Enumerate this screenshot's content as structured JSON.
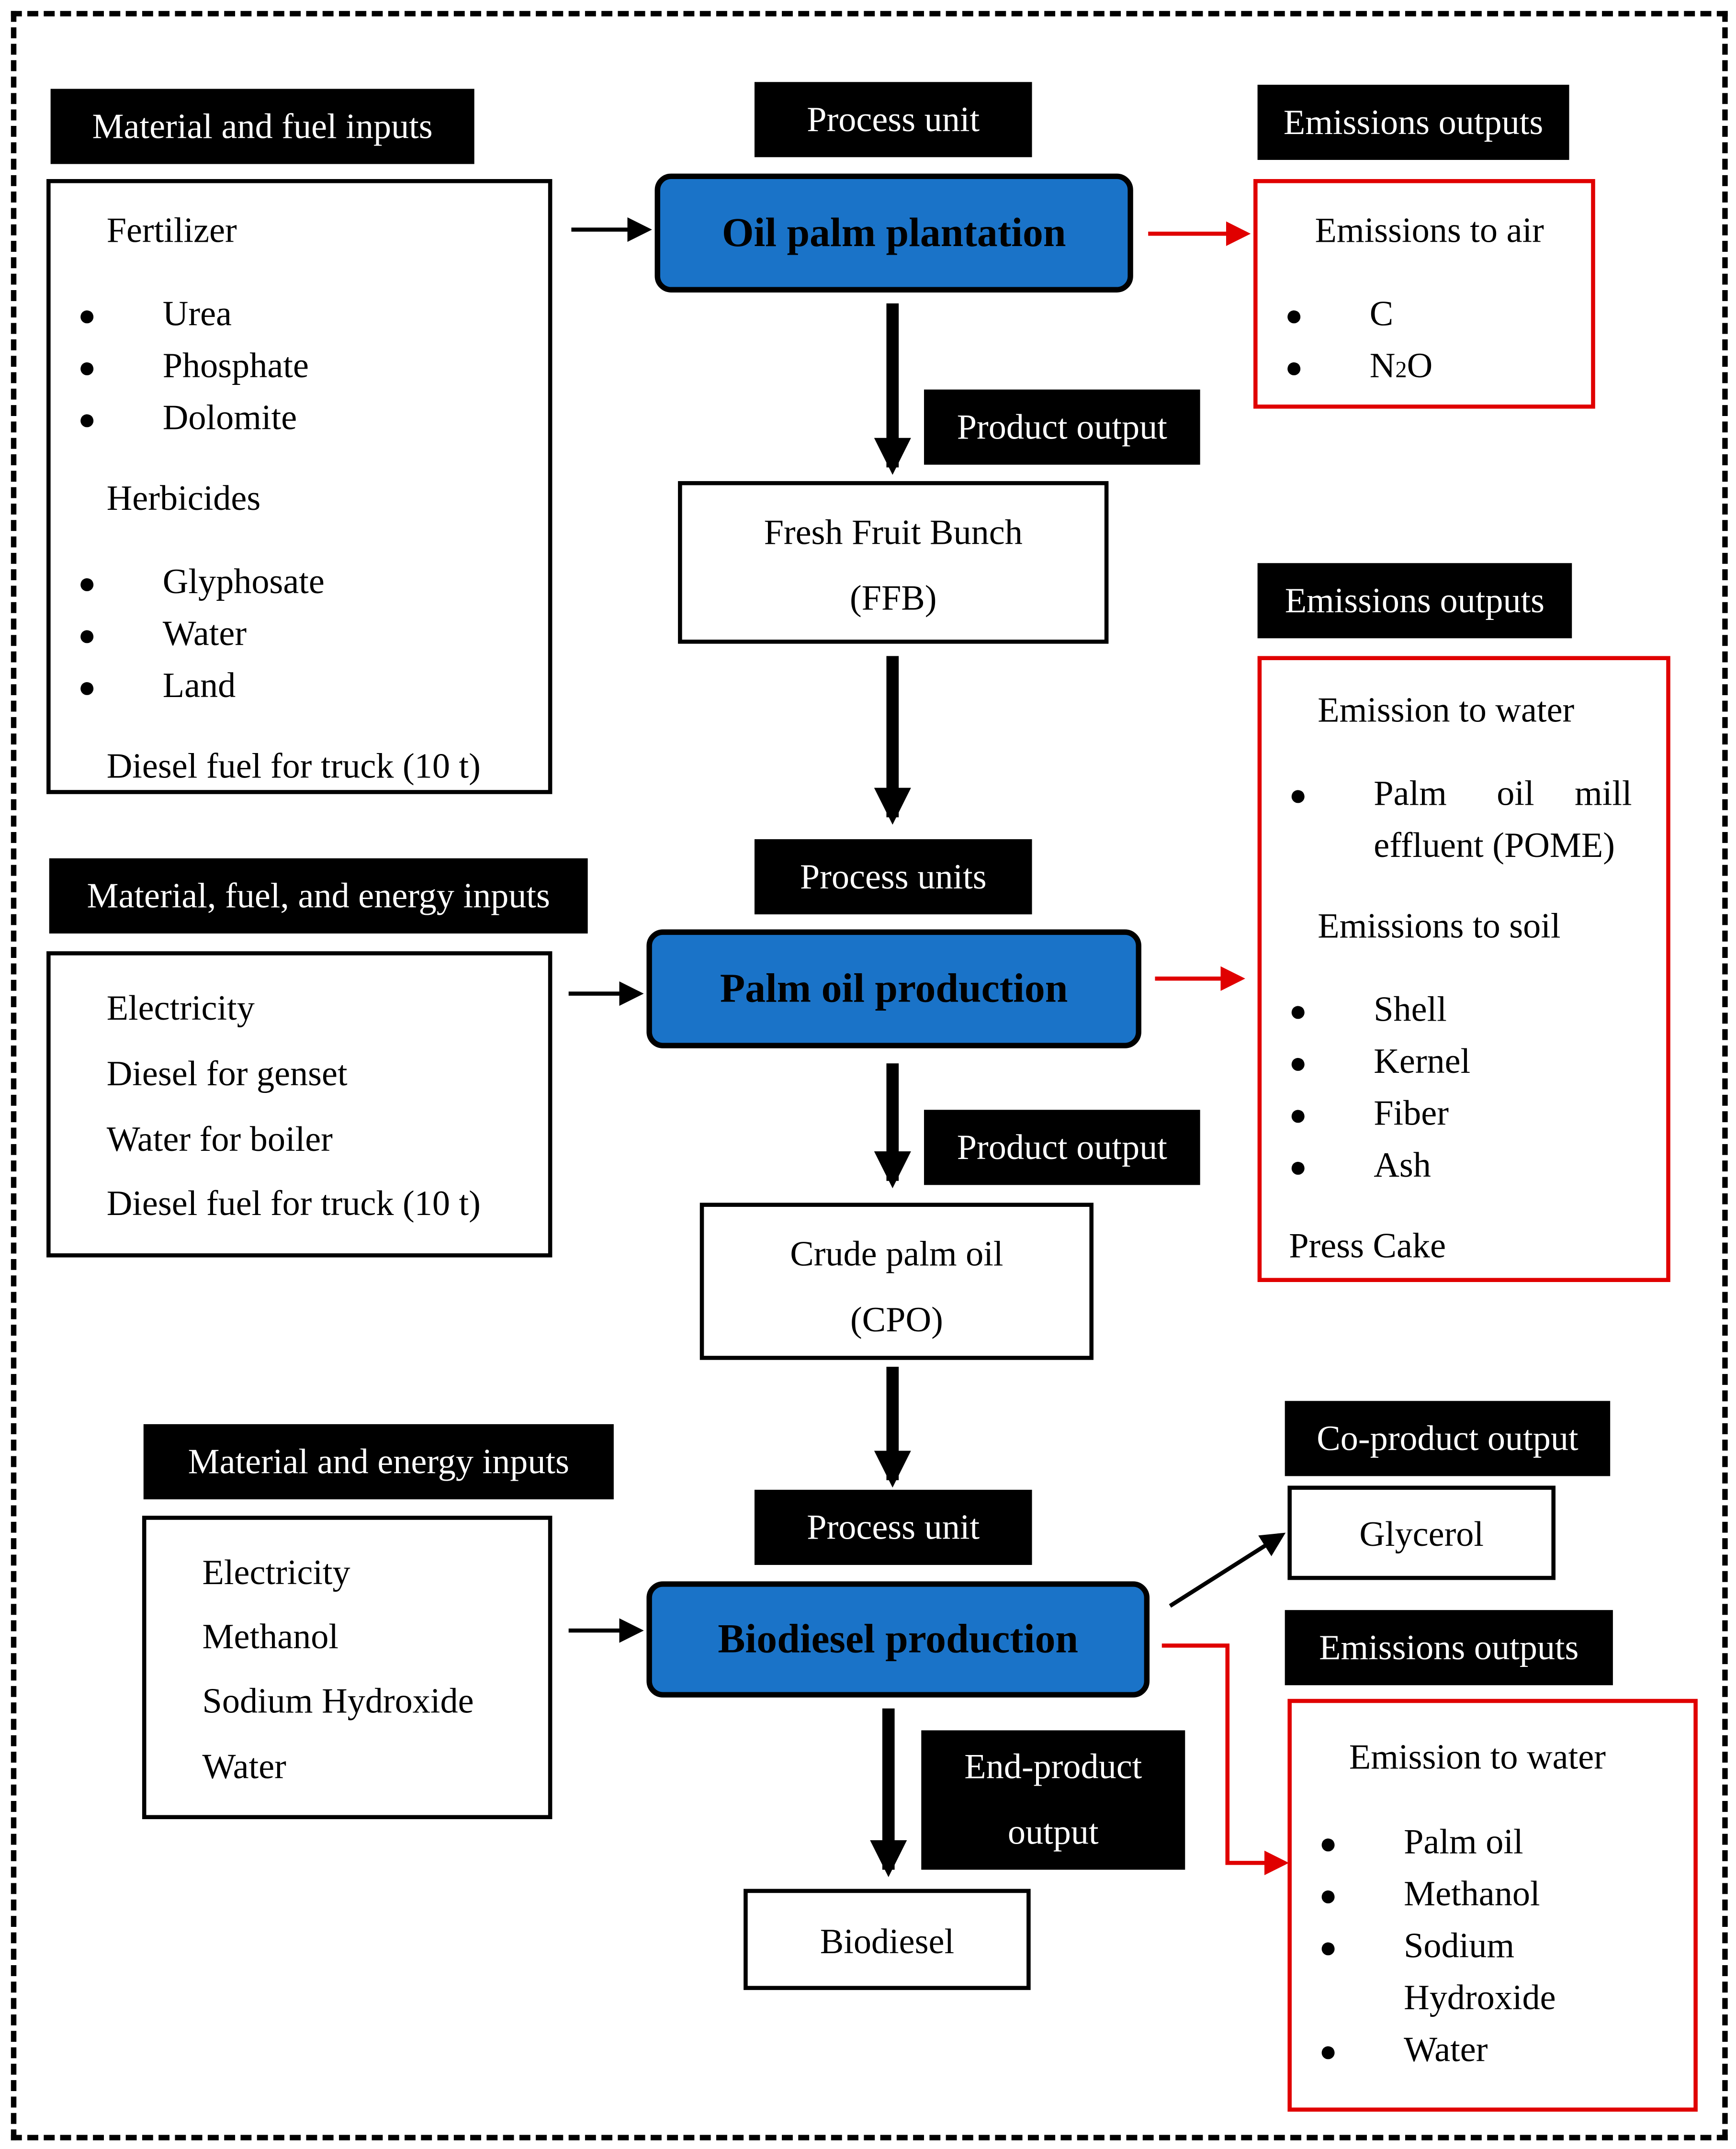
{
  "colors": {
    "process_fill": "#1a73c8",
    "emission_border": "#e00000",
    "label_bg": "#000000"
  },
  "labels": {
    "inputs1": "Material and fuel inputs",
    "process1": "Process unit",
    "emissions1": "Emissions outputs",
    "product1": "Product output",
    "emissions2": "Emissions outputs",
    "inputs2": "Material, fuel, and energy inputs",
    "process2": "Process units",
    "product2": "Product output",
    "inputs3": "Material and energy inputs",
    "coproduct": "Co-product output",
    "process3": "Process unit",
    "emissions3": "Emissions outputs",
    "endproduct1": "End-product",
    "endproduct2": "output"
  },
  "processes": [
    "Oil palm plantation",
    "Palm oil production",
    "Biodiesel production"
  ],
  "inputs1": {
    "h1": "Fertilizer",
    "fert": [
      "Urea",
      "Phosphate",
      "Dolomite"
    ],
    "h2": "Herbicides",
    "herb": [
      "Glyphosate",
      "Water",
      "Land"
    ],
    "diesel": "Diesel fuel for truck (10 t)"
  },
  "inputs2": [
    "Electricity",
    "Diesel for genset",
    "Water for boiler",
    "Diesel fuel for truck (10 t)"
  ],
  "inputs3": [
    "Electricity",
    "Methanol",
    "Sodium Hydroxide",
    "Water"
  ],
  "air": {
    "title": "Emissions to air",
    "items": [
      "C",
      "N",
      "2",
      "O"
    ]
  },
  "water1": {
    "title": "Emission to water",
    "pome1": "Palm",
    "pome2": "oil",
    "pome3": "mill",
    "pome4": "effluent (POME)",
    "soil": "Emissions to soil",
    "soil_items": [
      "Shell",
      "Kernel",
      "Fiber",
      "Ash"
    ],
    "press": "Press Cake"
  },
  "products": {
    "ffb1": "Fresh Fruit Bunch",
    "ffb2": "(FFB)",
    "cpo1": "Crude palm oil",
    "cpo2": "(CPO)",
    "glycerol": "Glycerol",
    "biodiesel": "Biodiesel"
  },
  "water3": {
    "title": "Emission to water",
    "items": [
      "Palm oil",
      "Methanol",
      "Sodium",
      "Hydroxide",
      "Water"
    ]
  }
}
